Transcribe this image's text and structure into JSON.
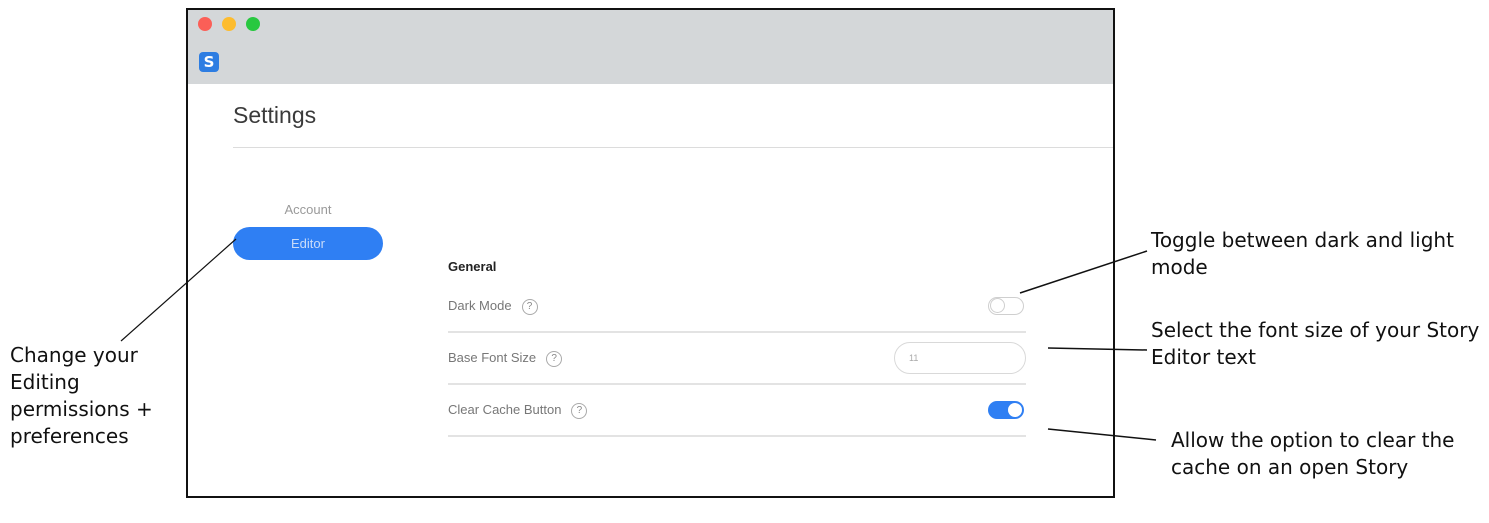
{
  "window": {
    "app_icon_letter": "S",
    "traffic_lights": [
      "close",
      "minimize",
      "zoom"
    ]
  },
  "page_title": "Settings",
  "nav": {
    "items": [
      {
        "label": "Account",
        "active": false
      },
      {
        "label": "Editor",
        "active": true
      }
    ]
  },
  "general": {
    "heading": "General",
    "help_glyph": "?",
    "rows": [
      {
        "label": "Dark Mode",
        "control": "toggle",
        "on": false
      },
      {
        "label": "Base Font Size",
        "control": "input",
        "placeholder": "11"
      },
      {
        "label": "Clear Cache Button",
        "control": "toggle",
        "on": true
      }
    ]
  },
  "annotations": {
    "editor_tab": "Change your Editing permissions + preferences",
    "dark_mode": "Toggle between dark and light mode",
    "font_size": "Select the font size of your Story Editor text",
    "clear_cache": "Allow the option to clear the cache on an open Story"
  },
  "colors": {
    "accent": "#2f7ff3",
    "titlebar": "#d4d7d9",
    "close": "#fb5f57",
    "minimize": "#fdbc2e",
    "zoom": "#28c840"
  }
}
